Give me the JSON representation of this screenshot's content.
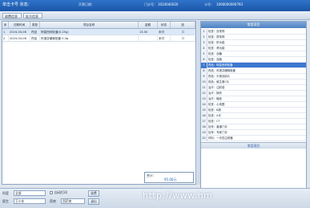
{
  "window": {
    "title": "单击卡号 状态：",
    "header_left": "工作号：",
    "header_mid": "开票日期：",
    "header_id_label": "门诊号：",
    "header_id_value": "1024040020",
    "header_card_label": "卡号：",
    "header_card_value": "1000000000793"
  },
  "toolbar": {
    "tab1": "收费信息",
    "tab2": "处方信息"
  },
  "grid": {
    "headers": [
      "序",
      "日期时间",
      "类型",
      "项目名称",
      "金额",
      "状态",
      "选"
    ],
    "rows": [
      {
        "idx": "1",
        "time": "2024-04-08",
        "type": "药品",
        "name": "阿莫西林胶囊(0.25g)",
        "amount": "13.50",
        "status": "未付",
        "check": "☐"
      },
      {
        "idx": "2",
        "time": "2024-04-08",
        "type": "药品",
        "name": "布洛芬缓释胶囊 0.3g",
        "amount": "",
        "status": "未付",
        "check": "☐"
      }
    ]
  },
  "right_panel": {
    "header": "常用项目",
    "footer": "常用项目",
    "items": [
      {
        "num": "1",
        "text": "检查：血常规",
        "value": ""
      },
      {
        "num": "2",
        "text": "检查：尿常规",
        "value": ""
      },
      {
        "num": "3",
        "text": "检查：肝功能",
        "value": ""
      },
      {
        "num": "4",
        "text": "检查：肾功能",
        "value": ""
      },
      {
        "num": "5",
        "text": "检查：血糖",
        "value": ""
      },
      {
        "num": "6",
        "text": "检查：血脂",
        "value": ""
      },
      {
        "num": "7",
        "text": "药品：阿莫西林胶囊",
        "value": ""
      },
      {
        "num": "8",
        "text": "药品：布洛芬缓释胶囊",
        "value": ""
      },
      {
        "num": "9",
        "text": "药品：头孢克肟片",
        "value": ""
      },
      {
        "num": "10",
        "text": "药品：维生素C片",
        "value": ""
      },
      {
        "num": "11",
        "text": "治疗：注射费",
        "value": ""
      },
      {
        "num": "12",
        "text": "治疗：换药",
        "value": ""
      },
      {
        "num": "13",
        "text": "治疗：输液",
        "value": ""
      },
      {
        "num": "14",
        "text": "检查：心电图",
        "value": ""
      },
      {
        "num": "15",
        "text": "检查：B超",
        "value": ""
      },
      {
        "num": "16",
        "text": "检查：X光",
        "value": ""
      },
      {
        "num": "17",
        "text": "检查：CT",
        "value": ""
      },
      {
        "num": "18",
        "text": "挂号：普通门诊",
        "value": ""
      },
      {
        "num": "19",
        "text": "挂号：专家门诊",
        "value": ""
      },
      {
        "num": "20",
        "text": "材料：一次性注射器",
        "value": ""
      }
    ]
  },
  "status_box": {
    "label": "合计：",
    "value": "95.00元"
  },
  "bottom": {
    "label1": "科室",
    "select1": "全部",
    "label2": "医生",
    "select2": "王小东",
    "label3": "药房",
    "select3": "西药房",
    "check_label": "自动打印",
    "btn_ok": "收费",
    "btn_cancel": "退出"
  },
  "watermark": "http://www.hm"
}
